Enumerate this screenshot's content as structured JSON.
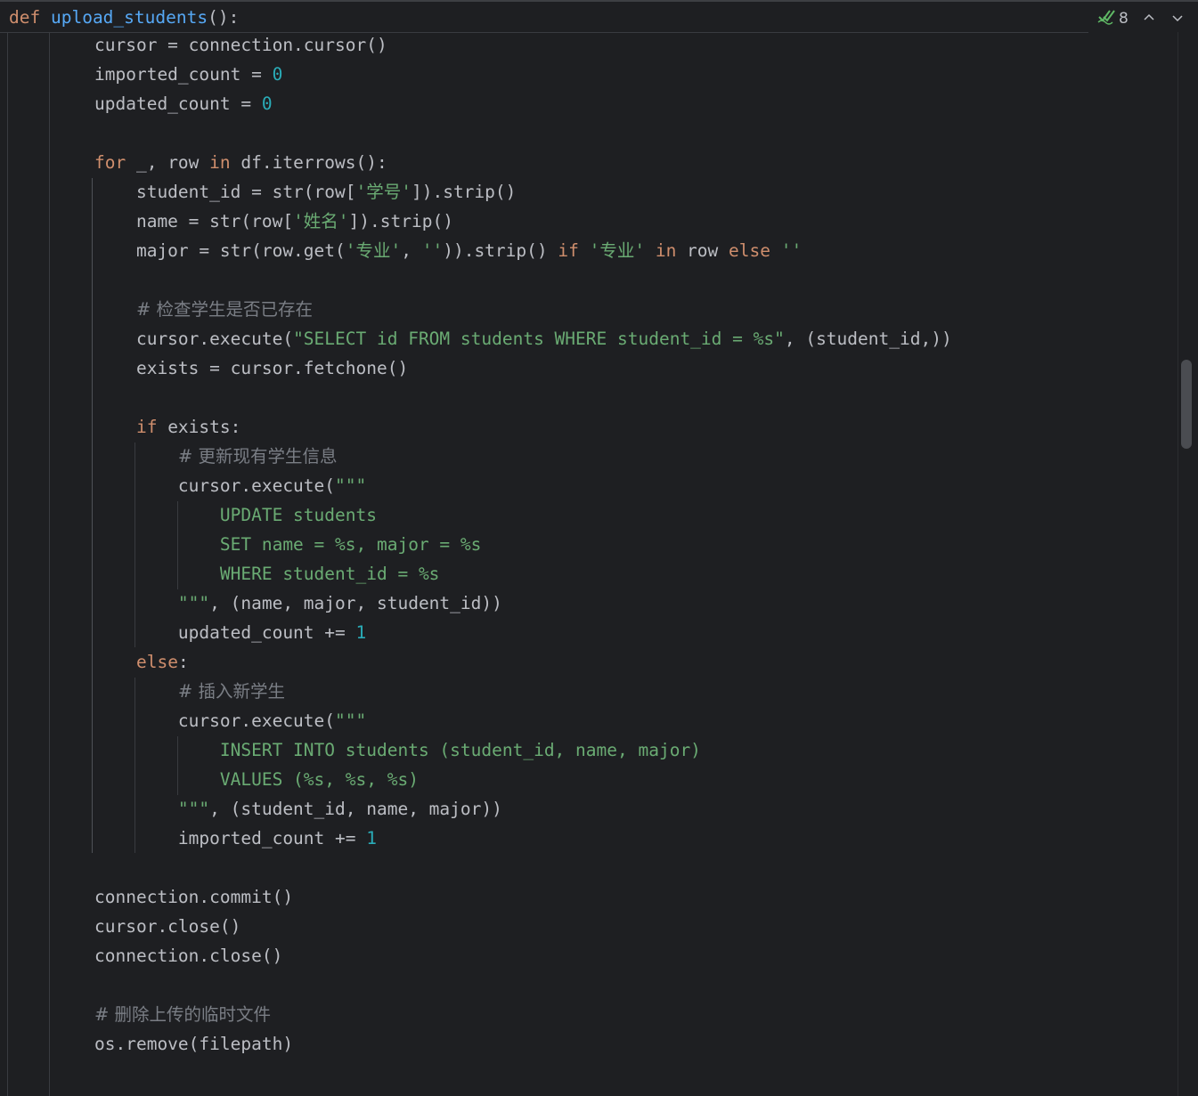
{
  "sticky_header": {
    "kw": "def",
    "name": "upload_students",
    "rest": "():"
  },
  "inspections": {
    "icon": "double-check-icon",
    "count": "8",
    "prev_icon": "chevron-up-icon",
    "next_icon": "chevron-down-icon"
  },
  "code": [
    [
      [
        "",
        "cursor = connection.cursor()"
      ]
    ],
    [
      [
        "",
        "imported_count = "
      ],
      [
        "num",
        "0"
      ]
    ],
    [
      [
        "",
        "updated_count = "
      ],
      [
        "num",
        "0"
      ]
    ],
    [],
    [
      [
        "kw",
        "for"
      ],
      [
        "",
        " _, row "
      ],
      [
        "kw",
        "in"
      ],
      [
        "",
        " df.iterrows():"
      ]
    ],
    [
      [
        "",
        "    student_id = str(row["
      ],
      [
        "str",
        "'学号'"
      ],
      [
        "",
        "]).strip()"
      ]
    ],
    [
      [
        "",
        "    name = str(row["
      ],
      [
        "str",
        "'姓名'"
      ],
      [
        "",
        "]).strip()"
      ]
    ],
    [
      [
        "",
        "    major = str(row.get("
      ],
      [
        "str",
        "'专业'"
      ],
      [
        "",
        ", "
      ],
      [
        "str",
        "''"
      ],
      [
        "",
        ")).strip() "
      ],
      [
        "kw",
        "if"
      ],
      [
        "",
        " "
      ],
      [
        "str",
        "'专业'"
      ],
      [
        "",
        " "
      ],
      [
        "kw",
        "in"
      ],
      [
        "",
        " row "
      ],
      [
        "kw",
        "else"
      ],
      [
        "",
        " "
      ],
      [
        "str",
        "''"
      ]
    ],
    [],
    [
      [
        "",
        "    "
      ],
      [
        "cm",
        "# 检查学生是否已存在"
      ]
    ],
    [
      [
        "",
        "    cursor.execute("
      ],
      [
        "str",
        "\"SELECT id FROM students WHERE student_id = %s\""
      ],
      [
        "",
        ", (student_id,))"
      ]
    ],
    [
      [
        "",
        "    exists = cursor.fetchone()"
      ]
    ],
    [],
    [
      [
        "",
        "    "
      ],
      [
        "kw",
        "if"
      ],
      [
        "",
        " exists:"
      ]
    ],
    [
      [
        "",
        "        "
      ],
      [
        "cm",
        "# 更新现有学生信息"
      ]
    ],
    [
      [
        "",
        "        cursor.execute("
      ],
      [
        "str",
        "\"\"\""
      ]
    ],
    [
      [
        "str",
        "            UPDATE students"
      ]
    ],
    [
      [
        "str",
        "            SET name = %s, major = %s"
      ]
    ],
    [
      [
        "str",
        "            WHERE student_id = %s"
      ]
    ],
    [
      [
        "str",
        "        \"\"\""
      ],
      [
        "",
        ", (name, major, student_id))"
      ]
    ],
    [
      [
        "",
        "        updated_count += "
      ],
      [
        "num",
        "1"
      ]
    ],
    [
      [
        "",
        "    "
      ],
      [
        "kw",
        "else"
      ],
      [
        "",
        ":"
      ]
    ],
    [
      [
        "",
        "        "
      ],
      [
        "cm",
        "# 插入新学生"
      ]
    ],
    [
      [
        "",
        "        cursor.execute("
      ],
      [
        "str",
        "\"\"\""
      ]
    ],
    [
      [
        "str",
        "            INSERT INTO students (student_id, name, major)"
      ]
    ],
    [
      [
        "str",
        "            VALUES (%s, %s, %s)"
      ]
    ],
    [
      [
        "str",
        "        \"\"\""
      ],
      [
        "",
        ", (student_id, name, major))"
      ]
    ],
    [
      [
        "",
        "        imported_count += "
      ],
      [
        "num",
        "1"
      ]
    ],
    [],
    [
      [
        "",
        "connection.commit()"
      ]
    ],
    [
      [
        "",
        "cursor.close()"
      ]
    ],
    [
      [
        "",
        "connection.close()"
      ]
    ],
    [],
    [
      [
        "cm",
        "# 删除上传的临时文件"
      ]
    ],
    [
      [
        "",
        "os.remove(filepath)"
      ]
    ]
  ]
}
